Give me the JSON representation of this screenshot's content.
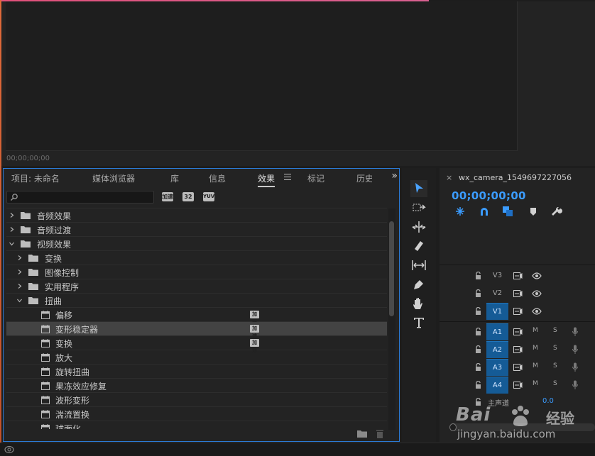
{
  "program_monitor": {
    "timecode": "00;00;00;00"
  },
  "effects_panel": {
    "tabs": [
      {
        "label": "项目: 未命名"
      },
      {
        "label": "媒体浏览器"
      },
      {
        "label": "库"
      },
      {
        "label": "信息"
      },
      {
        "label": "效果",
        "active": true
      },
      {
        "label": "标记"
      },
      {
        "label": "历史"
      }
    ],
    "tabs_more": "»",
    "search": {
      "value": "",
      "placeholder": ""
    },
    "filter_badges": [
      "加速",
      "32",
      "YUV"
    ],
    "tree": [
      {
        "label": "音频效果",
        "type": "folder",
        "level": 0,
        "expanded": false
      },
      {
        "label": "音频过渡",
        "type": "folder",
        "level": 0,
        "expanded": false
      },
      {
        "label": "视频效果",
        "type": "folder",
        "level": 0,
        "expanded": true
      },
      {
        "label": "变换",
        "type": "folder",
        "level": 1,
        "expanded": false
      },
      {
        "label": "图像控制",
        "type": "folder",
        "level": 1,
        "expanded": false
      },
      {
        "label": "实用程序",
        "type": "folder",
        "level": 1,
        "expanded": false
      },
      {
        "label": "扭曲",
        "type": "folder",
        "level": 1,
        "expanded": true
      },
      {
        "label": "偏移",
        "type": "effect",
        "level": 2,
        "accelerated": true
      },
      {
        "label": "变形稳定器",
        "type": "effect",
        "level": 2,
        "accelerated": true,
        "selected": true
      },
      {
        "label": "变换",
        "type": "effect",
        "level": 2,
        "accelerated": true
      },
      {
        "label": "放大",
        "type": "effect",
        "level": 2
      },
      {
        "label": "旋转扭曲",
        "type": "effect",
        "level": 2
      },
      {
        "label": "果冻效应修复",
        "type": "effect",
        "level": 2
      },
      {
        "label": "波形变形",
        "type": "effect",
        "level": 2
      },
      {
        "label": "湍流置换",
        "type": "effect",
        "level": 2
      },
      {
        "label": "球面化",
        "type": "effect",
        "level": 2
      }
    ],
    "accel_badge": "加速"
  },
  "tools": [
    "selection-tool",
    "track-select-tool",
    "ripple-edit-tool",
    "razor-tool",
    "slip-tool",
    "pen-tool",
    "hand-tool",
    "type-tool"
  ],
  "timeline": {
    "close": "×",
    "sequence_name": "wx_camera_1549697227056",
    "timecode": "00;00;00;00",
    "video_tracks": [
      {
        "name": "V3",
        "on": false
      },
      {
        "name": "V2",
        "on": false
      },
      {
        "name": "V1",
        "on": true
      }
    ],
    "audio_tracks": [
      {
        "name": "A1",
        "m": "M",
        "s": "S"
      },
      {
        "name": "A2",
        "m": "M",
        "s": "S"
      },
      {
        "name": "A3",
        "m": "M",
        "s": "S"
      },
      {
        "name": "A4",
        "m": "M",
        "s": "S"
      }
    ],
    "master": {
      "label": "主声道",
      "value": "0.0"
    }
  },
  "watermark": {
    "brand": "Bai",
    "suffix": "经验",
    "url": "jingyan.baidu.com"
  },
  "colors": {
    "accent_blue": "#3b9cff",
    "track_on": "#155b96",
    "panel_border": "#2b7bd6"
  }
}
